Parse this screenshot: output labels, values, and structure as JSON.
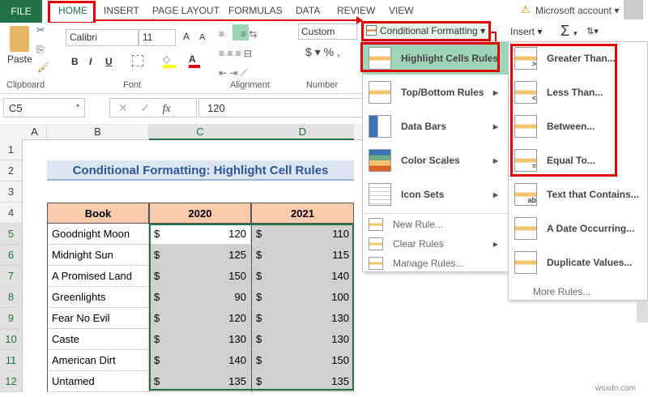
{
  "tabs": {
    "file": "FILE",
    "home": "HOME",
    "insert": "INSERT",
    "page_layout": "PAGE LAYOUT",
    "formulas": "FORMULAS",
    "data": "DATA",
    "review": "REVIEW",
    "view": "VIEW"
  },
  "account": "Microsoft account",
  "ribbon": {
    "paste": "Paste",
    "font_name": "Calibri",
    "font_size": "11",
    "number_format": "Custom",
    "conditional_formatting": "Conditional Formatting",
    "insert": "Insert",
    "groups": {
      "clipboard": "Clipboard",
      "font": "Font",
      "alignment": "Alignment",
      "number": "Number"
    }
  },
  "formula_bar": {
    "name_box": "C5",
    "fx": "fx",
    "value": "120"
  },
  "columns": [
    "A",
    "B",
    "C",
    "D"
  ],
  "rows": [
    "1",
    "2",
    "3",
    "4",
    "5",
    "6",
    "7",
    "8",
    "9",
    "10",
    "11",
    "12"
  ],
  "sheet": {
    "title": "Conditional Formatting: Highlight Cell Rules",
    "headers": [
      "Book",
      "2020",
      "2021"
    ],
    "currency": "$",
    "data": [
      [
        "Goodnight Moon",
        "120",
        "110"
      ],
      [
        "Midnight Sun",
        "125",
        "115"
      ],
      [
        "A Promised Land",
        "150",
        "140"
      ],
      [
        "Greenlights",
        "90",
        "100"
      ],
      [
        "Fear No Evil",
        "120",
        "130"
      ],
      [
        "Caste",
        "130",
        "130"
      ],
      [
        "American Dirt",
        "140",
        "150"
      ],
      [
        "Untamed",
        "135",
        "135"
      ]
    ]
  },
  "cf_menu": {
    "items": [
      "Highlight Cells Rules",
      "Top/Bottom Rules",
      "Data Bars",
      "Color Scales",
      "Icon Sets"
    ],
    "small": [
      "New Rule...",
      "Clear Rules",
      "Manage Rules..."
    ]
  },
  "submenu": {
    "items": [
      "Greater Than...",
      "Less Than...",
      "Between...",
      "Equal To...",
      "Text that Contains...",
      "A Date Occurring...",
      "Duplicate Values..."
    ],
    "more": "More Rules..."
  },
  "colors": {
    "excel_green": "#217346",
    "highlight": "#e00000",
    "menu_hover": "#9fd5b7",
    "header_fill": "#f8cbad",
    "title_fill": "#dce6f1",
    "selection": "#d0d0d0"
  }
}
